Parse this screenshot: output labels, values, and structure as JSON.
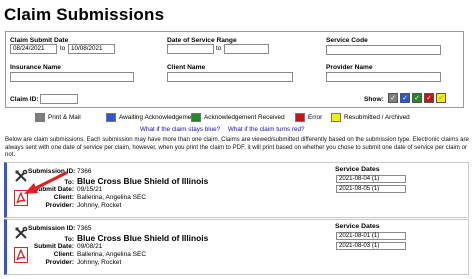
{
  "page_title": "Claim Submissions",
  "filters": {
    "submit_date_label": "Claim Submit Date",
    "submit_from": "08/24/2021",
    "to_text": "to",
    "submit_to": "10/08/2021",
    "service_range_label": "Date of Service Range",
    "service_from": "",
    "service_to": "",
    "service_code_label": "Service Code",
    "service_code": "",
    "insurance_label": "Insurance Name",
    "insurance": "",
    "client_label": "Client Name",
    "client": "",
    "provider_label": "Provider Name",
    "provider": "",
    "claim_id_label": "Claim ID:",
    "claim_id": "",
    "show_label": "Show:",
    "show_checks": [
      {
        "color": "#7f7f7f",
        "checked": true
      },
      {
        "color": "#2b57d8",
        "checked": true
      },
      {
        "color": "#1e8a28",
        "checked": true
      },
      {
        "color": "#cf1010",
        "checked": true
      },
      {
        "color": "#f0f000",
        "checked": true
      }
    ]
  },
  "legend": [
    {
      "label": "Print & Mail",
      "color": "#7f7f7f"
    },
    {
      "label": "Awaiting Acknowledgement",
      "color": "#2b57d8"
    },
    {
      "label": "Acknowledgement Received",
      "color": "#1e8a28"
    },
    {
      "label": "Error",
      "color": "#cf1010"
    },
    {
      "label": "Resubmitted / Archived",
      "color": "#f0f000"
    }
  ],
  "help_links": {
    "blue": "What if the claim stays blue?",
    "red": "What if the claim turns red?"
  },
  "description": "Below are claim submissions. Each submission may have more than one claim. Claims are viewed/submitted differently based on the submission type. Electronic claims are always sent with one date of service per claim, however, when you print the claim to PDF, it will print based on whether you chose to submit one date of service per claim or not.",
  "field_labels": {
    "submission_id": "Submission ID:",
    "to": "To:",
    "submit_date": "Submit Date:",
    "client": "Client:",
    "provider": "Provider:",
    "service_dates": "Service Dates"
  },
  "submissions": [
    {
      "submission_id": "7366",
      "to": "Blue Cross Blue Shield of Illinois",
      "submit_date": "09/15/21",
      "client": "Ballerina, Angelina SEC",
      "provider": "Johnny, Rocket",
      "service_dates": [
        "2021-08-04 (1)",
        "2021-08-05 (1)"
      ]
    },
    {
      "submission_id": "7365",
      "to": "Blue Cross Blue Shield of Illinois",
      "submit_date": "09/08/21",
      "client": "Ballerina, Angelina SEC",
      "provider": "Johnny, Rocket",
      "service_dates": [
        "2021-08-01 (1)",
        "2021-08-03 (1)"
      ]
    }
  ],
  "colors": {
    "card_accent": "#3a55c8",
    "link": "#1a0dab",
    "annotation_arrow": "#e02020",
    "pdf_icon": "#d8231f"
  },
  "icons": {
    "tools": "wrench-screwdriver-icon",
    "pdf": "pdf-icon",
    "annotation": "red-arrow-annotation"
  }
}
